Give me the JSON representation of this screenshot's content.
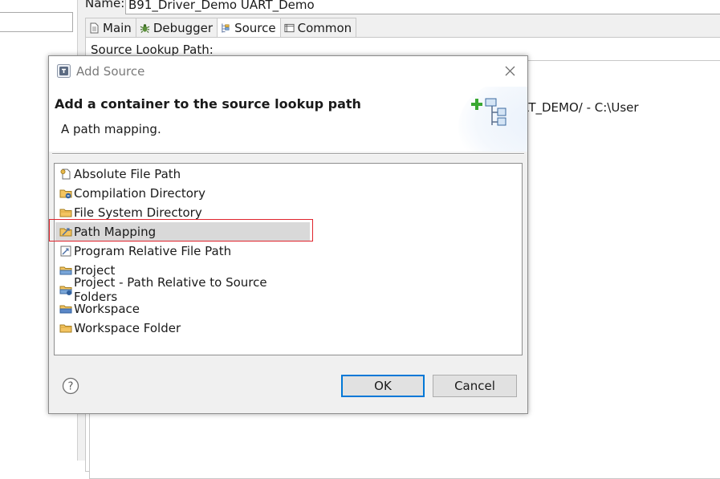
{
  "background": {
    "name_label": "Name:",
    "name_value": "B91_Driver_Demo UART_Demo",
    "tabs": [
      {
        "label": "Main",
        "icon": "document-icon"
      },
      {
        "label": "Debugger",
        "icon": "bug-icon"
      },
      {
        "label": "Source",
        "icon": "source-icon"
      },
      {
        "label": "Common",
        "icon": "common-icon"
      }
    ],
    "active_tab": "Source",
    "lookup_label": "Source Lookup Path:",
    "path_text": "o/vendor/UART_DEMO/ - C:\\User"
  },
  "dialog": {
    "title": "Add Source",
    "header_title": "Add a container to the source lookup path",
    "header_desc": "A path mapping.",
    "items": [
      {
        "label": "Absolute File Path",
        "icon": "absolute-file-path-icon"
      },
      {
        "label": "Compilation Directory",
        "icon": "compilation-directory-icon"
      },
      {
        "label": "File System Directory",
        "icon": "folder-icon"
      },
      {
        "label": "Path Mapping",
        "icon": "path-mapping-icon"
      },
      {
        "label": "Program Relative File Path",
        "icon": "program-relative-icon"
      },
      {
        "label": "Project",
        "icon": "project-icon"
      },
      {
        "label": "Project - Path Relative to Source Folders",
        "icon": "project-relative-icon"
      },
      {
        "label": "Workspace",
        "icon": "workspace-icon"
      },
      {
        "label": "Workspace Folder",
        "icon": "folder-icon"
      }
    ],
    "selected_item": "Path Mapping",
    "ok_label": "OK",
    "cancel_label": "Cancel",
    "accent_color": "#0078d7",
    "highlight_color": "#e0252d"
  }
}
